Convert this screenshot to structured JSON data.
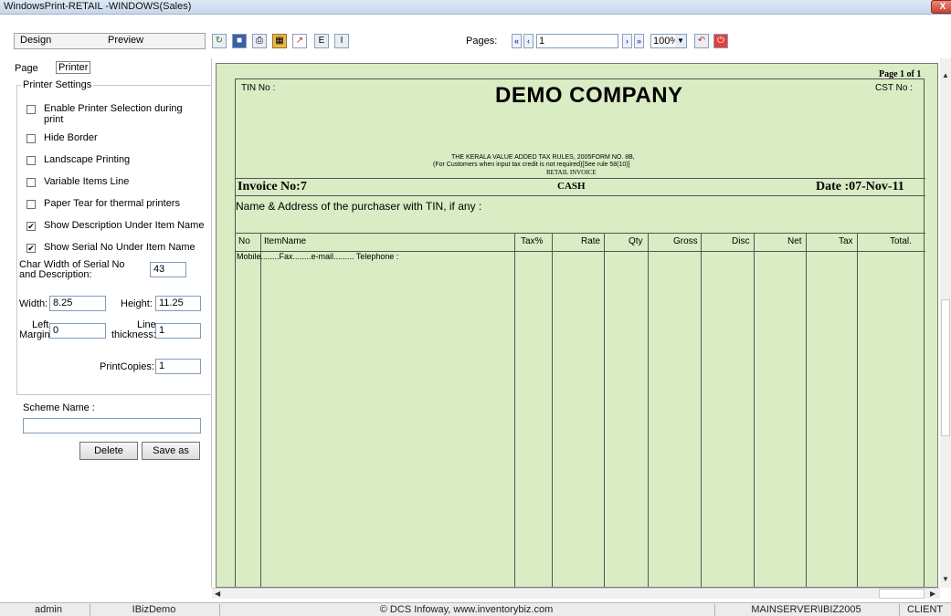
{
  "window": {
    "title": "WindowsPrint-RETAIL -WINDOWS(Sales)",
    "close_label": "X"
  },
  "top_tabs": {
    "design": "Design",
    "preview": "Preview"
  },
  "toolbar": {
    "icons": [
      "refresh-icon",
      "save-icon",
      "print-icon",
      "grid-icon",
      "pdf-icon",
      "E",
      "I"
    ],
    "e_label": "E",
    "i_label": "I",
    "pages_label": "Pages:",
    "page_value": "1",
    "zoom_value": "100%"
  },
  "left_panel": {
    "tab_page": "Page",
    "tab_printer": "Printer",
    "group_title": "Printer Settings",
    "checkboxes": [
      {
        "label": "Enable Printer Selection during",
        "label2": "print",
        "checked": false
      },
      {
        "label": "Hide Border",
        "checked": false
      },
      {
        "label": "Landscape Printing",
        "checked": false
      },
      {
        "label": "Variable Items Line",
        "checked": false
      },
      {
        "label": "Paper Tear for thermal printers",
        "checked": false
      },
      {
        "label": "Show Description Under Item Name",
        "checked": true
      },
      {
        "label": "Show Serial No Under Item Name",
        "checked": true
      }
    ],
    "char_width_label1": "Char Width of Serial No",
    "char_width_label2": "and Description:",
    "char_width_value": "43",
    "width_label": "Width:",
    "width_value": "8.25",
    "height_label": "Height:",
    "height_value": "11.25",
    "left_margin_label1": "Left",
    "left_margin_label2": "Margin:",
    "left_margin_value": "0",
    "line_thickness_label1": "Line",
    "line_thickness_label2": "thickness:",
    "line_thickness_value": "1",
    "print_copies_label": "PrintCopies:",
    "print_copies_value": "1",
    "scheme_name_label": "Scheme Name :",
    "scheme_name_value": "",
    "delete_button": "Delete",
    "save_as_button": "Save as"
  },
  "invoice": {
    "page_of": "Page 1 of 1",
    "tin_no": "TIN No :",
    "cst_no": "CST No :",
    "company": "DEMO COMPANY",
    "rule_line1": "THE KERALA VALUE ADDED TAX RULES, 2005FORM NO. 8B,",
    "rule_line2": "(For Customers when input tax credit is not required)[See rule 58(10)]",
    "rule_line3": "RETAIL INVOICE",
    "invoice_no": "Invoice No:7",
    "payment": "CASH",
    "date": "Date :07-Nov-11",
    "purchaser": "Name & Address of the purchaser with TIN, if any :",
    "columns": [
      "No",
      "ItemName",
      "Tax%",
      "Rate",
      "Qty",
      "Gross",
      "Disc",
      "Net",
      "Tax",
      "Total."
    ],
    "contact_line": "Mobile........Fax........e-mail......... Telephone :"
  },
  "status_bar": {
    "user": "admin",
    "company": "IBizDemo",
    "copyright": "© DCS Infoway, www.inventorybiz.com",
    "server": "MAINSERVER\\IBIZ2005",
    "mode": "CLIENT"
  }
}
